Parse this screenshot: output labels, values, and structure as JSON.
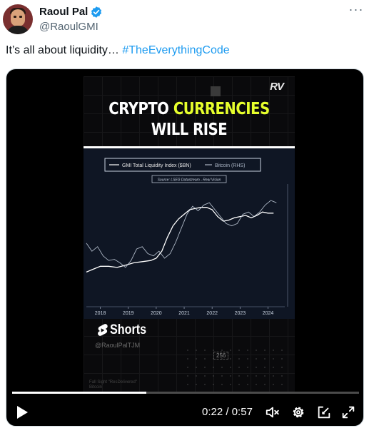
{
  "author": {
    "name": "Raoul Pal",
    "handle": "@RaoulGMI",
    "verified": true
  },
  "more_icon": "ellipsis-icon",
  "tweet": {
    "text": "It’s all about liquidity… ",
    "hashtag": "#TheEverythingCode"
  },
  "video": {
    "logo": "RV",
    "headline_line1_white": "CRYPTO ",
    "headline_line1_accent": "CURRENCIES",
    "headline_line2": "WILL RISE",
    "accent_color": "#e7ff2c",
    "shorts_label": "Shorts",
    "channel_label": "@RaoulPalTJM",
    "code_number": "256",
    "tiny_note": [
      "Fall Sight \"ResDelivered\"",
      "Bitcoin"
    ],
    "time_current": "0:22",
    "time_total": "0:57",
    "progress_fraction": 0.386,
    "icons": [
      "play-icon",
      "volume-icon",
      "settings-icon",
      "pip-icon",
      "fullscreen-icon"
    ]
  },
  "chart_data": {
    "type": "line",
    "legend": [
      "GMI Total Liquidity Index ($BN)",
      "Bitcoin (RHS)"
    ],
    "source": "Source: LSEG Datastream - Real Vision",
    "x_ticks": [
      "2018",
      "2019",
      "2020",
      "2021",
      "2022",
      "2023",
      "2024"
    ],
    "xlim": [
      2017.5,
      2024.6
    ],
    "ylim": [
      0,
      100
    ],
    "series": [
      {
        "name": "GMI Total Liquidity Index ($BN)",
        "color": "#ffffff",
        "x": [
          2017.5,
          2017.8,
          2018.0,
          2018.3,
          2018.6,
          2018.9,
          2019.2,
          2019.5,
          2019.8,
          2020.0,
          2020.2,
          2020.4,
          2020.6,
          2020.8,
          2021.0,
          2021.2,
          2021.4,
          2021.6,
          2021.8,
          2022.0,
          2022.2,
          2022.4,
          2022.6,
          2022.8,
          2023.0,
          2023.2,
          2023.4,
          2023.6,
          2023.8,
          2024.0,
          2024.2
        ],
        "y": [
          30,
          33,
          35,
          35,
          34,
          36,
          38,
          39,
          40,
          42,
          48,
          60,
          70,
          76,
          80,
          84,
          85,
          86,
          86,
          84,
          78,
          74,
          75,
          77,
          78,
          79,
          77,
          79,
          82,
          81,
          81
        ]
      },
      {
        "name": "Bitcoin (RHS)",
        "color": "#c8d2e0",
        "x": [
          2017.5,
          2017.7,
          2017.9,
          2018.1,
          2018.3,
          2018.5,
          2018.7,
          2018.9,
          2019.1,
          2019.3,
          2019.5,
          2019.7,
          2019.9,
          2020.1,
          2020.3,
          2020.5,
          2020.7,
          2020.9,
          2021.1,
          2021.3,
          2021.5,
          2021.7,
          2021.9,
          2022.1,
          2022.3,
          2022.5,
          2022.7,
          2022.9,
          2023.1,
          2023.3,
          2023.5,
          2023.7,
          2023.9,
          2024.1,
          2024.3
        ],
        "y": [
          55,
          48,
          52,
          44,
          40,
          41,
          38,
          34,
          40,
          50,
          52,
          46,
          44,
          48,
          42,
          46,
          56,
          68,
          80,
          87,
          83,
          88,
          90,
          84,
          78,
          72,
          70,
          72,
          80,
          82,
          78,
          82,
          88,
          92,
          90
        ]
      }
    ]
  }
}
